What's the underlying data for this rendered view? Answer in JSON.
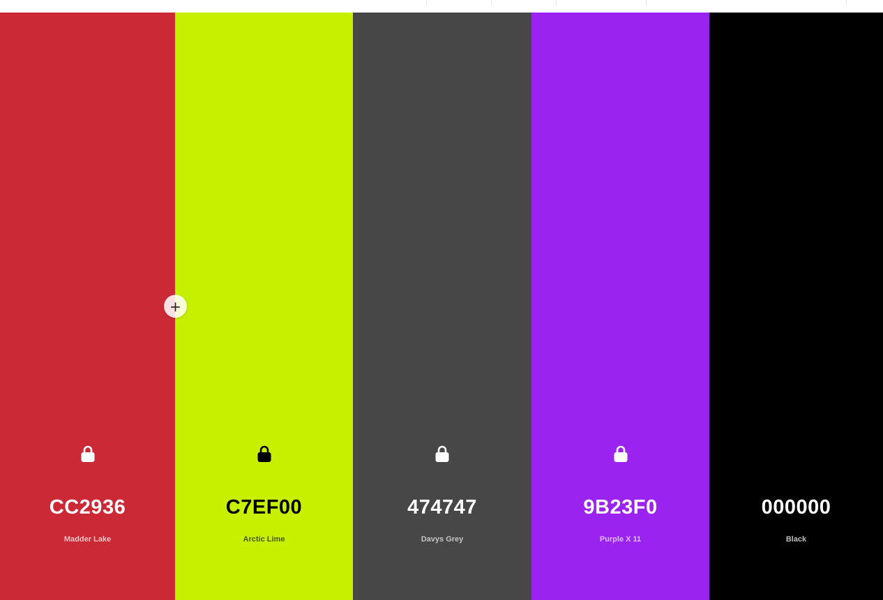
{
  "add_button": {
    "label": "+"
  },
  "swatches": [
    {
      "hex": "CC2936",
      "name": "Madder Lake",
      "bg": "#CC2936",
      "fg": "#ffffff",
      "name_color": "#f1c4c8",
      "lock_icon": "lock-icon"
    },
    {
      "hex": "C7EF00",
      "name": "Arctic Lime",
      "bg": "#C7EF00",
      "fg": "#000000",
      "name_color": "#4a5a00",
      "lock_icon": "lock-icon"
    },
    {
      "hex": "474747",
      "name": "Davys Grey",
      "bg": "#474747",
      "fg": "#ffffff",
      "name_color": "#c4c4c4",
      "lock_icon": "lock-icon"
    },
    {
      "hex": "9B23F0",
      "name": "Purple X 11",
      "bg": "#9B23F0",
      "fg": "#ffffff",
      "name_color": "#dcbdf9",
      "lock_icon": "lock-icon"
    },
    {
      "hex": "000000",
      "name": "Black",
      "bg": "#000000",
      "fg": "#ffffff",
      "name_color": "#bdbdbd",
      "lock_icon": null
    }
  ]
}
